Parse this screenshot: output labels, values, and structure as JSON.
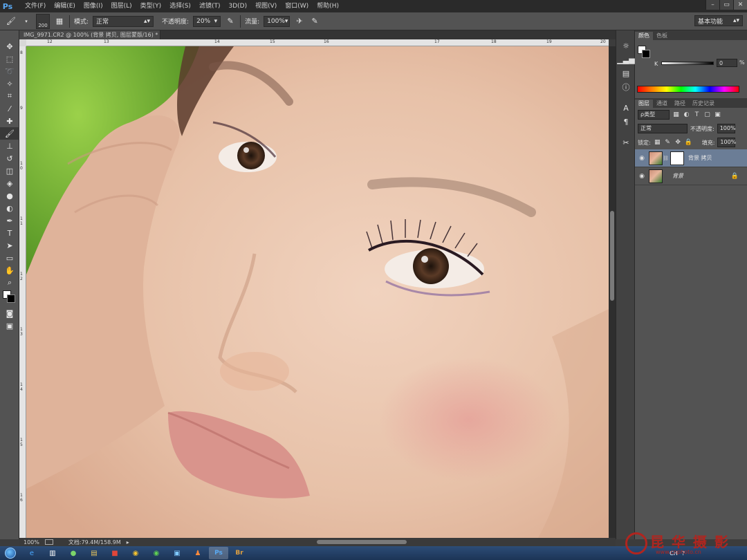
{
  "app": {
    "logo": "Ps"
  },
  "menu": [
    "文件(F)",
    "编辑(E)",
    "图像(I)",
    "图层(L)",
    "类型(Y)",
    "选择(S)",
    "滤镜(T)",
    "3D(D)",
    "视图(V)",
    "窗口(W)",
    "帮助(H)"
  ],
  "window_controls": {
    "minimize": "–",
    "restore": "▭",
    "close": "✕"
  },
  "options": {
    "brush_size": "200",
    "mode_label": "模式:",
    "mode_value": "正常",
    "opacity_label": "不透明度:",
    "opacity_value": "20%",
    "flow_label": "流量:",
    "flow_value": "100%",
    "workspace": "基本功能"
  },
  "document": {
    "tab_title": "IMG_9971.CR2 @ 100% (背景 拷贝, 图层蒙版/16) *",
    "zoom": "100%",
    "doc_size": "文档:79.4M/158.9M"
  },
  "ruler_h": [
    "12",
    "13",
    "14",
    "15",
    "16",
    "17",
    "18",
    "19",
    "20"
  ],
  "ruler_v": [
    "8",
    "9",
    "1\n0",
    "1\n1",
    "1\n2",
    "1\n3",
    "1\n4",
    "1\n5",
    "1\n6"
  ],
  "color_panel": {
    "tabs": [
      "颜色",
      "色板"
    ],
    "channel_label": "K",
    "k_value": "0",
    "k_unit": "%"
  },
  "layers_panel": {
    "tabs": [
      "图层",
      "通道",
      "路径",
      "历史记录"
    ],
    "filter_kind": "ρ类型",
    "blend_mode": "正常",
    "opacity_label": "不透明度:",
    "opacity_value": "100%",
    "lock_label": "锁定:",
    "fill_label": "填充:",
    "fill_value": "100%",
    "layers": [
      {
        "name": "背景 拷贝",
        "selected": true,
        "has_mask": true,
        "locked": false
      },
      {
        "name": "背景",
        "selected": false,
        "has_mask": false,
        "locked": true
      }
    ]
  },
  "taskbar": {
    "tray_lang": "CH",
    "apps": [
      "ie-icon",
      "explorer-icon",
      "media-icon",
      "folder-icon",
      "app-red-icon",
      "chrome-icon",
      "app-green-icon",
      "app-blue-icon",
      "app-people-icon",
      "photoshop-icon",
      "bridge-icon"
    ]
  },
  "watermark": {
    "text": "昆 华 摄 影",
    "url": "www.cnphoto.cn"
  }
}
